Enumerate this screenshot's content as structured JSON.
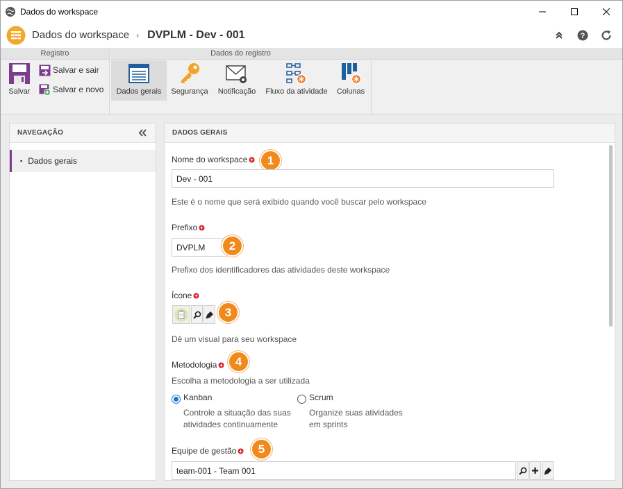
{
  "window": {
    "title": "Dados do workspace"
  },
  "header": {
    "crumb_root": "Dados do workspace",
    "crumb_separator": "›",
    "crumb_current": "DVPLM - Dev - 001"
  },
  "ribbon": {
    "groups": {
      "registro": "Registro",
      "dados_registro": "Dados do registro"
    },
    "salvar": "Salvar",
    "salvar_sair": "Salvar e sair",
    "salvar_novo": "Salvar e novo",
    "dados_gerais": "Dados gerais",
    "seguranca": "Segurança",
    "notificacao": "Notificação",
    "fluxo": "Fluxo da atividade",
    "colunas": "Colunas"
  },
  "nav": {
    "title": "NAVEGAÇÃO",
    "items": [
      {
        "label": "Dados gerais",
        "bullet": "▪"
      }
    ]
  },
  "main": {
    "title": "DADOS GERAIS",
    "nome": {
      "label": "Nome do workspace",
      "value": "Dev - 001",
      "hint": "Este é o nome que será exibido quando você buscar pelo workspace",
      "badge": "1"
    },
    "prefixo": {
      "label": "Prefixo",
      "value": "DVPLM",
      "hint": "Prefixo dos identificadores das atividades deste workspace",
      "badge": "2"
    },
    "icone": {
      "label": "Ícone",
      "hint": "Dê um visual para seu workspace",
      "badge": "3"
    },
    "metodologia": {
      "label": "Metodologia",
      "hint": "Escolha a metodologia a ser utilizada",
      "badge": "4",
      "options": [
        {
          "label": "Kanban",
          "desc1": "Controle a situação das suas",
          "desc2": "atividades continuamente",
          "selected": true
        },
        {
          "label": "Scrum",
          "desc1": "Organize suas atividades",
          "desc2": "em sprints",
          "selected": false
        }
      ]
    },
    "equipe": {
      "label": "Equipe de gestão",
      "value": "team-001 - Team 001",
      "badge": "5"
    }
  },
  "colors": {
    "accent_purple": "#7b3d8c",
    "badge_orange": "#f08a1c",
    "radio_blue": "#1a73d9",
    "required_red": "#d9232d"
  }
}
